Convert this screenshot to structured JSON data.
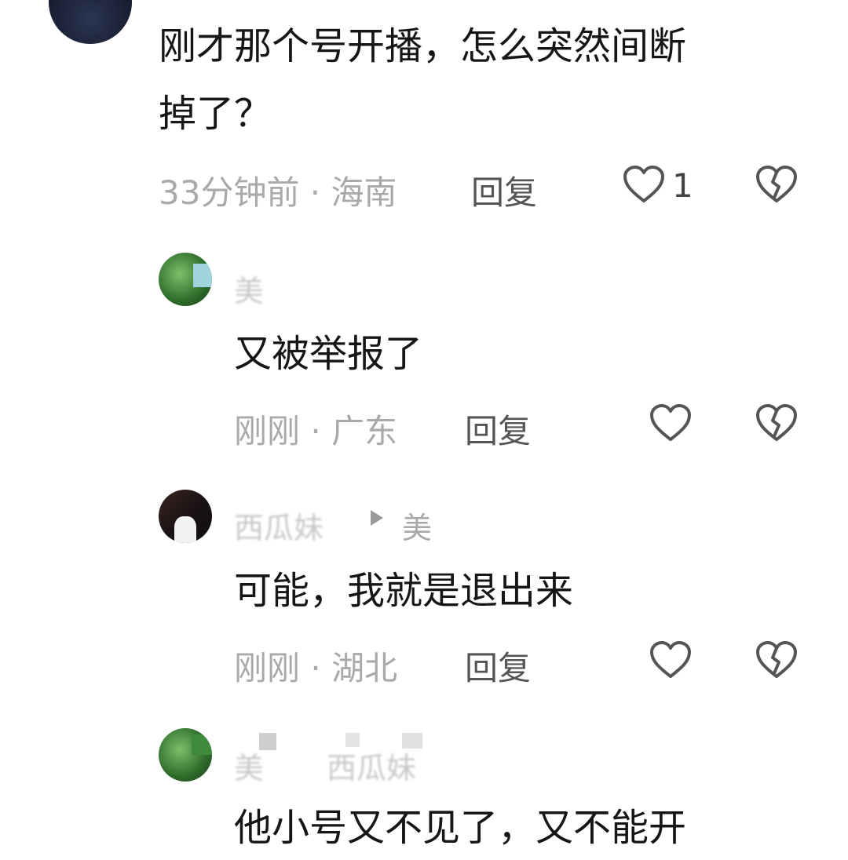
{
  "comments": [
    {
      "text_line1": "刚才那个号开播，怎么突然间断",
      "text_line2": "掉了？",
      "time": "33分钟前",
      "location": "海南",
      "reply_label": "回复",
      "like_count": "1"
    },
    {
      "username": "美",
      "text": "又被举报了",
      "time": "刚刚",
      "location": "广东",
      "reply_label": "回复"
    },
    {
      "username": "西瓜妹",
      "reply_to": "美",
      "text": "可能，我就是退出来",
      "time": "刚刚",
      "location": "湖北",
      "reply_label": "回复"
    },
    {
      "username": "美",
      "reply_to": "西瓜妹",
      "text": "他小号又不见了，又不能开"
    }
  ],
  "separator": " · "
}
